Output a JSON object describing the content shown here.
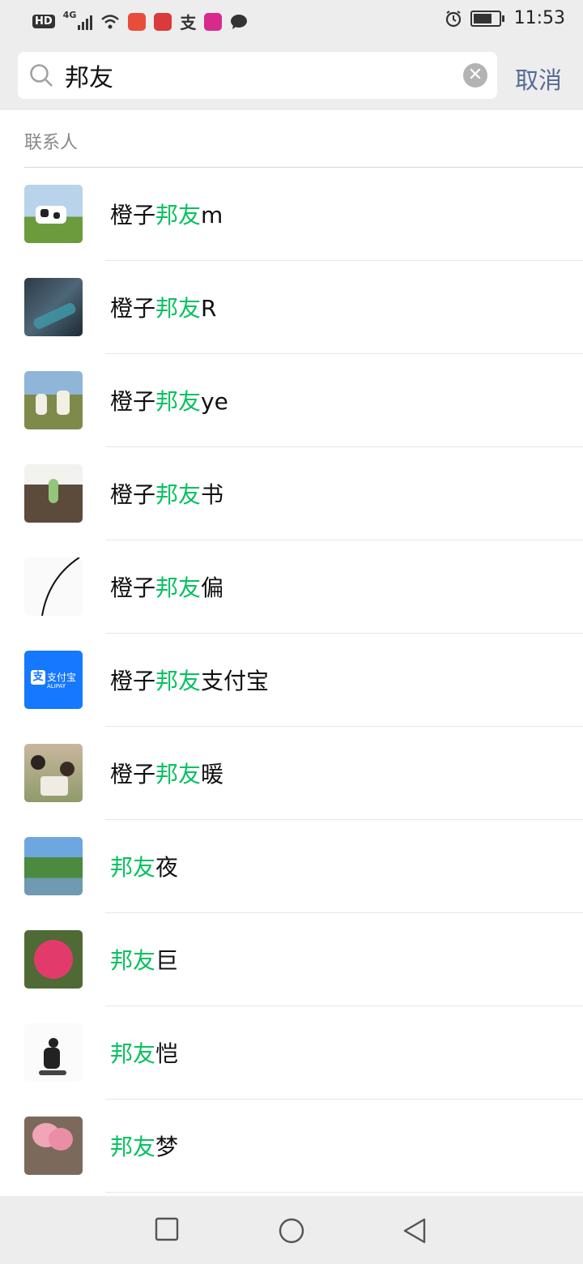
{
  "status_bar": {
    "time": "11:53",
    "network": "4G",
    "hd_label": "HD",
    "icons": [
      "signal-icon",
      "wifi-icon",
      "app-icon",
      "app-icon",
      "alipay-icon",
      "app-icon",
      "chat-icon",
      "alarm-icon",
      "battery-icon"
    ]
  },
  "search": {
    "query": "邦友",
    "cancel_label": "取消"
  },
  "section_title": "联系人",
  "highlight_color": "#07c160",
  "contacts": [
    {
      "prefix": "橙子",
      "highlight": "邦友",
      "suffix": "m"
    },
    {
      "prefix": "橙子",
      "highlight": "邦友",
      "suffix": "R"
    },
    {
      "prefix": "橙子",
      "highlight": "邦友",
      "suffix": "ye"
    },
    {
      "prefix": "橙子",
      "highlight": "邦友",
      "suffix": "书"
    },
    {
      "prefix": "橙子",
      "highlight": "邦友",
      "suffix": "偏"
    },
    {
      "prefix": "橙子",
      "highlight": "邦友",
      "suffix": "支付宝"
    },
    {
      "prefix": "橙子",
      "highlight": "邦友",
      "suffix": "暖"
    },
    {
      "prefix": "",
      "highlight": "邦友",
      "suffix": "夜"
    },
    {
      "prefix": "",
      "highlight": "邦友",
      "suffix": "巨"
    },
    {
      "prefix": "",
      "highlight": "邦友",
      "suffix": "恺"
    },
    {
      "prefix": "",
      "highlight": "邦友",
      "suffix": "梦"
    }
  ],
  "avatar_label": {
    "alipay_text": "支付宝",
    "alipay_sub": "ALIPAY"
  }
}
